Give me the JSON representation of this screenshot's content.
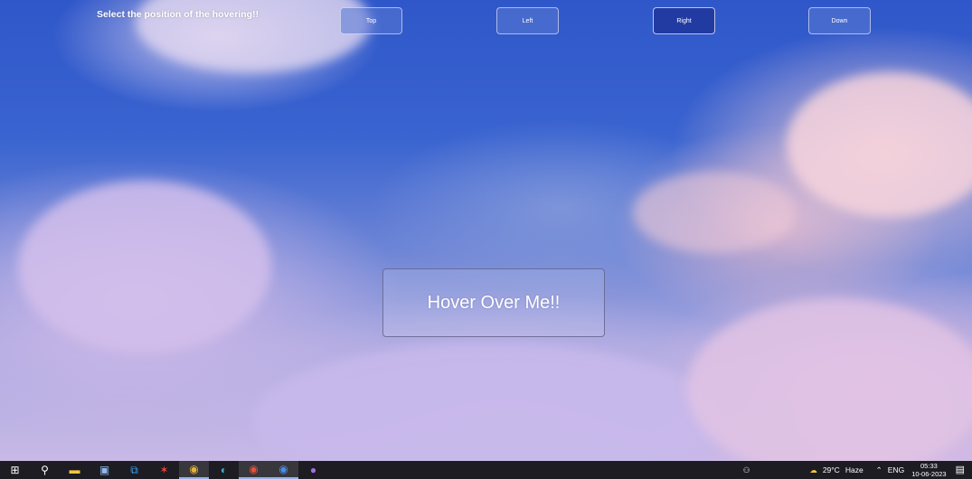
{
  "page": {
    "instruction": "Select the position of the hovering!!",
    "position_buttons": [
      {
        "label": "Top",
        "selected": false
      },
      {
        "label": "Left",
        "selected": false
      },
      {
        "label": "Right",
        "selected": true
      },
      {
        "label": "Down",
        "selected": false
      }
    ],
    "hover_box_label": "Hover Over Me!!"
  },
  "taskbar": {
    "apps": [
      {
        "icon": "windows-start-icon",
        "glyph": "⊞",
        "color": "#ffffff",
        "running": false
      },
      {
        "icon": "search-icon",
        "glyph": "⚲",
        "color": "#ffffff",
        "running": false
      },
      {
        "icon": "file-explorer-icon",
        "glyph": "▬",
        "color": "#f3c343",
        "running": false
      },
      {
        "icon": "network-app-icon",
        "glyph": "▣",
        "color": "#8fb8e8",
        "running": false
      },
      {
        "icon": "vscode-icon",
        "glyph": "⧉",
        "color": "#3ea0f0",
        "running": false
      },
      {
        "icon": "app-red-icon",
        "glyph": "✶",
        "color": "#e04a3a",
        "running": false
      },
      {
        "icon": "chrome-icon",
        "glyph": "◉",
        "color": "#e8b33a",
        "running": true
      },
      {
        "icon": "edge-icon",
        "glyph": "◐",
        "color": "#3bb3d6",
        "running": false
      },
      {
        "icon": "chrome-icon",
        "glyph": "◉",
        "color": "#e8503a",
        "running": true
      },
      {
        "icon": "chrome-icon",
        "glyph": "◉",
        "color": "#4a8ee8",
        "running": true
      },
      {
        "icon": "github-icon",
        "glyph": "●",
        "color": "#a070e0",
        "running": false
      }
    ],
    "tray": {
      "weather_temp": "29°C",
      "weather_desc": "Haze",
      "language": "ENG",
      "time": "05:33",
      "date": "10-06-2023"
    }
  }
}
